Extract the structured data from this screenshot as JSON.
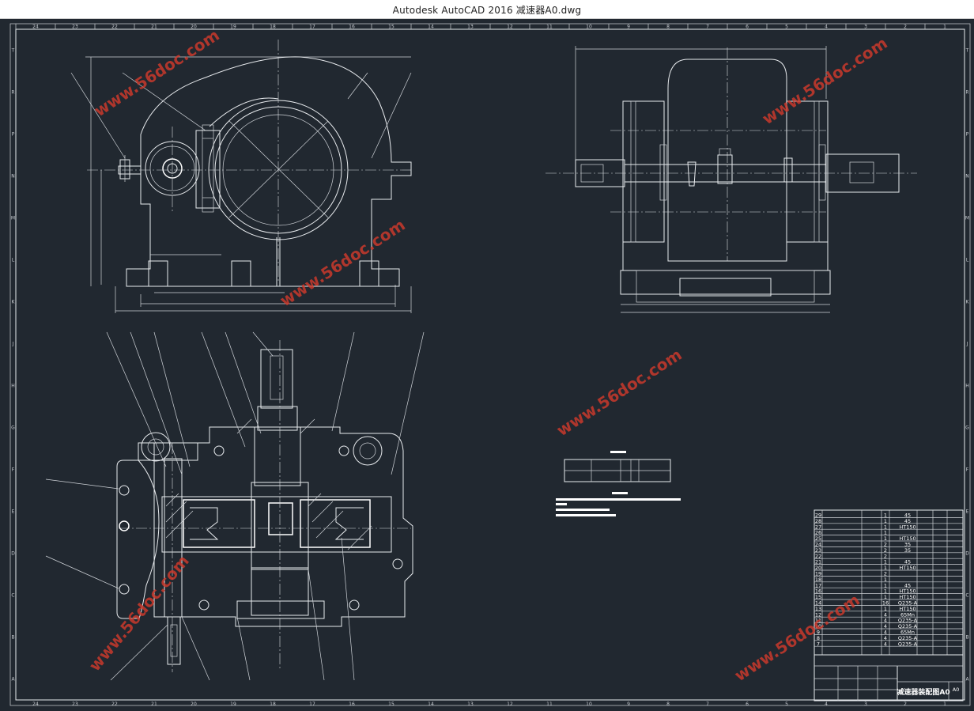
{
  "window": {
    "title": "Autodesk AutoCAD 2016    减速器A0.dwg"
  },
  "watermark": {
    "text": "www.56doc.com",
    "color": "#d03a2c"
  },
  "drawing": {
    "frame_top_numbers": [
      "24",
      "23",
      "22",
      "21",
      "20",
      "19",
      "18",
      "17",
      "16",
      "15",
      "14",
      "13",
      "12",
      "11",
      "10",
      "9",
      "8",
      "7",
      "6",
      "5",
      "4",
      "3",
      "2",
      "1"
    ],
    "frame_side_letters": [
      "T",
      "R",
      "P",
      "N",
      "M",
      "L",
      "K",
      "J",
      "H",
      "G",
      "F",
      "E",
      "D",
      "C",
      "B",
      "A"
    ],
    "colors": {
      "background": "#212830",
      "lines": "#e8ebee",
      "bright": "#ffffff"
    }
  },
  "title_block": {
    "drawing_title": "减速器装配图A0",
    "sheet_size": "A0",
    "parts_list": [
      {
        "no": "29",
        "qty": "1",
        "material": "45"
      },
      {
        "no": "28",
        "qty": "1",
        "material": "45"
      },
      {
        "no": "27",
        "qty": "1",
        "material": "HT150"
      },
      {
        "no": "26",
        "qty": "1",
        "material": ""
      },
      {
        "no": "25",
        "qty": "1",
        "material": "HT150"
      },
      {
        "no": "24",
        "qty": "2",
        "material": "35"
      },
      {
        "no": "23",
        "qty": "2",
        "material": "35"
      },
      {
        "no": "22",
        "qty": "2",
        "material": ""
      },
      {
        "no": "21",
        "qty": "1",
        "material": "45"
      },
      {
        "no": "20",
        "qty": "1",
        "material": "HT150"
      },
      {
        "no": "19",
        "qty": "2",
        "material": ""
      },
      {
        "no": "18",
        "qty": "1",
        "material": ""
      },
      {
        "no": "17",
        "qty": "1",
        "material": "45"
      },
      {
        "no": "16",
        "qty": "1",
        "material": "HT150"
      },
      {
        "no": "15",
        "qty": "1",
        "material": "HT150"
      },
      {
        "no": "14",
        "qty": "16",
        "material": "Q235-A"
      },
      {
        "no": "13",
        "qty": "1",
        "material": "HT150"
      },
      {
        "no": "12",
        "qty": "4",
        "material": "65Mn"
      },
      {
        "no": "11",
        "qty": "4",
        "material": "Q235-A"
      },
      {
        "no": "10",
        "qty": "4",
        "material": "Q235-A"
      },
      {
        "no": "9",
        "qty": "4",
        "material": "65Mn"
      },
      {
        "no": "8",
        "qty": "4",
        "material": "Q235-A"
      },
      {
        "no": "7",
        "qty": "4",
        "material": "Q235-A"
      }
    ]
  }
}
